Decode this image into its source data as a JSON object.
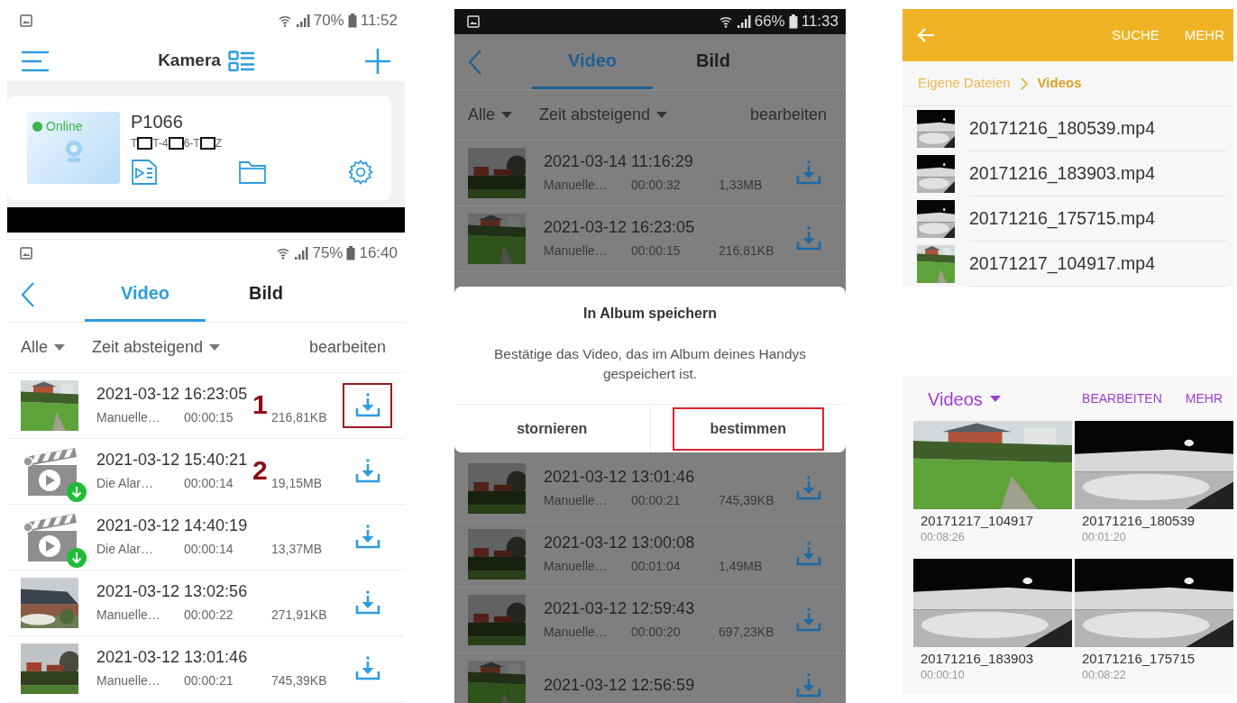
{
  "camera_screen": {
    "status_bar": {
      "battery": "70%",
      "time": "11:52"
    },
    "title": "Kamera",
    "camera": {
      "status": "Online",
      "name": "P1066",
      "serial_parts": [
        "T",
        "T-4",
        "6-T",
        "Z"
      ]
    }
  },
  "video_list_screen": {
    "status_bar": {
      "battery": "75%",
      "time": "16:40"
    },
    "tabs": [
      {
        "label": "Video",
        "selected": true
      },
      {
        "label": "Bild",
        "selected": false
      }
    ],
    "filters": {
      "type": "Alle",
      "sort": "Zeit absteigend",
      "edit": "bearbeiten"
    },
    "rows": [
      {
        "kind": "picture",
        "downloaded": false,
        "datetime": "2021-03-12 16:23:05",
        "source": "Manuelle…",
        "duration": "00:00:15",
        "annotation": "1",
        "size": "216,81KB",
        "highlighted": true
      },
      {
        "kind": "clapper",
        "downloaded": true,
        "datetime": "2021-03-12 15:40:21",
        "source": "Die Alar…",
        "duration": "00:00:14",
        "annotation": "2",
        "size": "19,15MB",
        "highlighted": false
      },
      {
        "kind": "clapper",
        "downloaded": true,
        "datetime": "2021-03-12 14:40:19",
        "source": "Die Alar…",
        "duration": "00:00:14",
        "size": "13,37MB",
        "highlighted": false
      },
      {
        "kind": "picture",
        "downloaded": false,
        "datetime": "2021-03-12 13:02:56",
        "source": "Manuelle…",
        "duration": "00:00:22",
        "size": "271,91KB",
        "highlighted": false
      },
      {
        "kind": "picture",
        "downloaded": false,
        "datetime": "2021-03-12 13:01:46",
        "source": "Manuelle…",
        "duration": "00:00:21",
        "size": "745,39KB",
        "highlighted": false
      }
    ]
  },
  "save_dialog_screen": {
    "status_bar": {
      "battery": "66%",
      "time": "11:33"
    },
    "tabs": [
      {
        "label": "Video",
        "selected": true
      },
      {
        "label": "Bild",
        "selected": false
      }
    ],
    "filters": {
      "type": "Alle",
      "sort": "Zeit absteigend",
      "edit": "bearbeiten"
    },
    "rows_above": [
      {
        "kind": "picture",
        "datetime": "2021-03-14 11:16:29",
        "source": "Manuelle…",
        "duration": "00:00:32",
        "size": "1,33MB"
      },
      {
        "kind": "picture",
        "datetime": "2021-03-12 16:23:05",
        "source": "Manuelle…",
        "duration": "00:00:15",
        "size": "216,81KB"
      }
    ],
    "dialog": {
      "title": "In Album speichern",
      "message": "Bestätige das Video, das im Album deines Handys gespeichert ist.",
      "buttons": [
        {
          "label": "stornieren",
          "highlighted": false
        },
        {
          "label": "bestimmen",
          "highlighted": true
        }
      ]
    },
    "rows_below": [
      {
        "kind": "picture",
        "datetime": "2021-03-12 13:01:46",
        "source": "Manuelle…",
        "duration": "00:00:21",
        "size": "745,39KB"
      },
      {
        "kind": "picture",
        "datetime": "2021-03-12 13:00:08",
        "source": "Manuelle…",
        "duration": "00:01:04",
        "size": "1,49MB"
      },
      {
        "kind": "picture",
        "datetime": "2021-03-12 12:59:43",
        "source": "Manuelle…",
        "duration": "00:00:20",
        "size": "697,23KB"
      },
      {
        "kind": "picture",
        "datetime": "2021-03-12 12:56:59"
      }
    ]
  },
  "file_manager": {
    "actions": [
      "SUCHE",
      "MEHR"
    ],
    "breadcrumb": [
      {
        "label": "Eigene Dateien",
        "current": false
      },
      {
        "label": "Videos",
        "current": true
      }
    ],
    "files": [
      "20171216_180539.mp4",
      "20171216_183903.mp4",
      "20171216_175715.mp4",
      "20171217_104917.mp4"
    ]
  },
  "gallery": {
    "album": "Videos",
    "actions": [
      "BEARBEITEN",
      "MEHR"
    ],
    "items": [
      {
        "name": "20171217_104917",
        "duration": "00:08:26"
      },
      {
        "name": "20171216_180539",
        "duration": "00:01:20"
      },
      {
        "name": "20171216_183903",
        "duration": "00:00:10"
      },
      {
        "name": "20171216_175715",
        "duration": "00:08:22"
      }
    ]
  }
}
